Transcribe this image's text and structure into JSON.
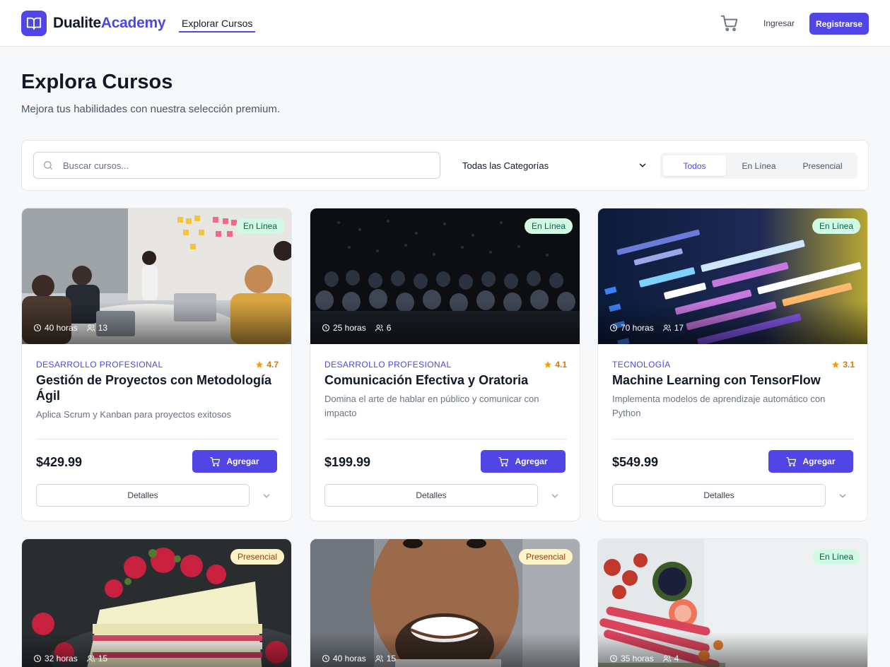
{
  "header": {
    "brand_part1": "Dualite",
    "brand_part2": "Academy",
    "nav_link": "Explorar Cursos",
    "login_label": "Ingresar",
    "register_label": "Registrarse"
  },
  "page": {
    "title": "Explora Cursos",
    "subtitle": "Mejora tus habilidades con nuestra selección premium."
  },
  "filters": {
    "search_placeholder": "Buscar cursos...",
    "category_selected": "Todas las Categorías",
    "modes": [
      "Todos",
      "En Línea",
      "Presencial"
    ],
    "active_mode": "Todos"
  },
  "courses": [
    {
      "badge": "En Línea",
      "hours": "40 horas",
      "students": "13",
      "category": "DESARROLLO PROFESIONAL",
      "rating": "4.7",
      "title": "Gestión de Proyectos con Metodología Ágil",
      "description": "Aplica Scrum y Kanban para proyectos exitosos",
      "price": "$429.99",
      "add_label": "Agregar",
      "details_label": "Detalles"
    },
    {
      "badge": "En Línea",
      "hours": "25 horas",
      "students": "6",
      "category": "DESARROLLO PROFESIONAL",
      "rating": "4.1",
      "title": "Comunicación Efectiva y Oratoria",
      "description": "Domina el arte de hablar en público y comunicar con impacto",
      "price": "$199.99",
      "add_label": "Agregar",
      "details_label": "Detalles"
    },
    {
      "badge": "En Línea",
      "hours": "70 horas",
      "students": "17",
      "category": "TECNOLOGÍA",
      "rating": "3.1",
      "title": "Machine Learning con TensorFlow",
      "description": "Implementa modelos de aprendizaje automático con Python",
      "price": "$549.99",
      "add_label": "Agregar",
      "details_label": "Detalles"
    },
    {
      "badge": "Presencial",
      "hours": "32 horas",
      "students": "15"
    },
    {
      "badge": "Presencial",
      "hours": "40 horas",
      "students": "15"
    },
    {
      "badge": "En Línea",
      "hours": "35 horas",
      "students": "4"
    }
  ],
  "colors": {
    "accent": "#4f46e5",
    "online_badge": "#d1fae5",
    "presencial_badge": "#fef3c7",
    "rating": "#d97706"
  }
}
